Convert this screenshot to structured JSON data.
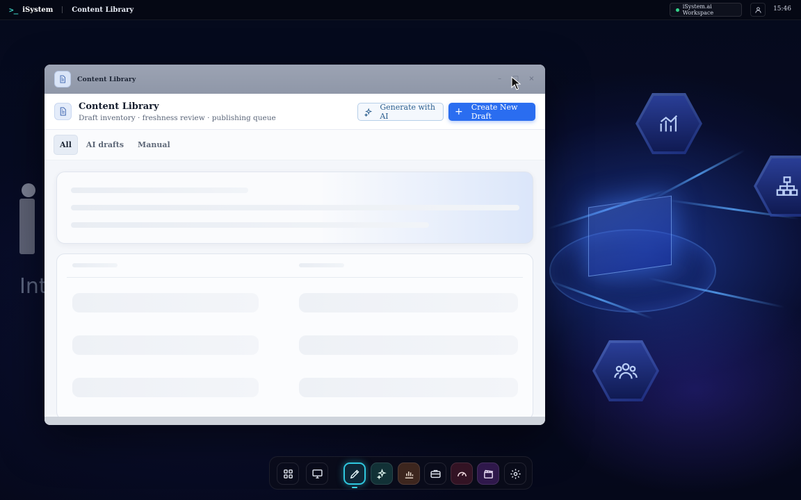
{
  "topbar": {
    "logo_glyph": ">_",
    "brand": "iSystem",
    "app_name": "Content Library",
    "workspace": "iSystem.ai Workspace",
    "workspace_status_color": "#35d48c",
    "time": "15:46"
  },
  "background": {
    "hero_text": "Int"
  },
  "window": {
    "title": "Content Library",
    "controls": {
      "minimize": "–",
      "maximize": "□",
      "close": "×"
    },
    "header": {
      "title": "Content Library",
      "subtitle": "Draft inventory · freshness review · publishing queue",
      "generate_label": "Generate with AI",
      "create_label": "Create New Draft",
      "create_icon": "+",
      "accent_color": "#2a6df0"
    },
    "tabs": [
      {
        "label": "All",
        "active": true
      },
      {
        "label": "AI drafts",
        "active": false
      },
      {
        "label": "Manual",
        "active": false
      }
    ]
  },
  "dock": {
    "items": [
      {
        "name": "apps-grid-icon"
      },
      {
        "name": "monitor-icon"
      },
      {
        "name": "pen-tool-icon",
        "active": true
      },
      {
        "name": "sparkles-icon"
      },
      {
        "name": "bar-chart-icon"
      },
      {
        "name": "briefcase-icon"
      },
      {
        "name": "gauge-icon"
      },
      {
        "name": "clapperboard-icon"
      },
      {
        "name": "settings-icon"
      }
    ]
  }
}
